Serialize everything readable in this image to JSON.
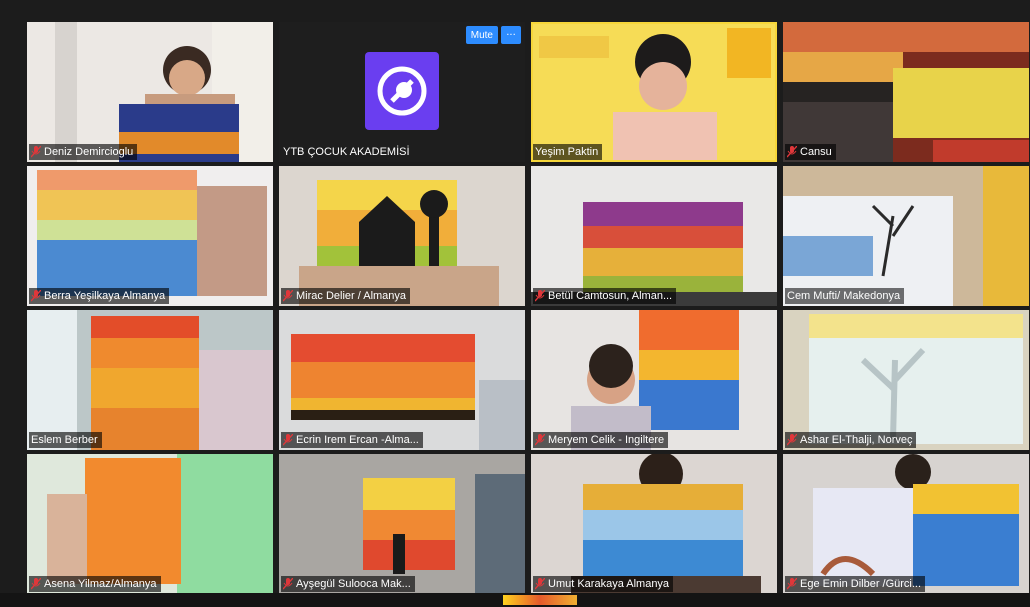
{
  "tiles": [
    {
      "name": "Deniz Demircioglu",
      "muted": true
    },
    {
      "name": "YTB ÇOCUK AKADEMİSİ",
      "muted": false,
      "mute_label": "Mute",
      "more_label": "···"
    },
    {
      "name": "Yeşim Paktin",
      "muted": false
    },
    {
      "name": "Cansu",
      "muted": true
    },
    {
      "name": "Berra Yeşilkaya Almanya",
      "muted": true
    },
    {
      "name": "Mirac Delier / Almanya",
      "muted": true
    },
    {
      "name": "Betül Camtosun, Alman...",
      "muted": true
    },
    {
      "name": "Cem Mufti/ Makedonya",
      "muted": false
    },
    {
      "name": "Eslem Berber",
      "muted": false
    },
    {
      "name": "Ecrin Irem Ercan -Alma...",
      "muted": true
    },
    {
      "name": "Meryem Celik - Ingiltere",
      "muted": true
    },
    {
      "name": "Ashar El-Thalji, Norveç",
      "muted": true
    },
    {
      "name": "Asena Yilmaz/Almanya",
      "muted": true
    },
    {
      "name": "Ayşegül Sulooca Mak...",
      "muted": true
    },
    {
      "name": "Umut Karakaya Almanya",
      "muted": true
    },
    {
      "name": "Ege Emin Dilber /Gürci...",
      "muted": true
    }
  ],
  "colors": {
    "active_speaker_border": "#f6d63a",
    "mute_button": "#2d8cff",
    "muted_mic": "#e0373a"
  },
  "icons": {
    "muted": "microphone-muted-icon",
    "more": "more-options-icon",
    "logo": "ytb-logo-icon"
  }
}
